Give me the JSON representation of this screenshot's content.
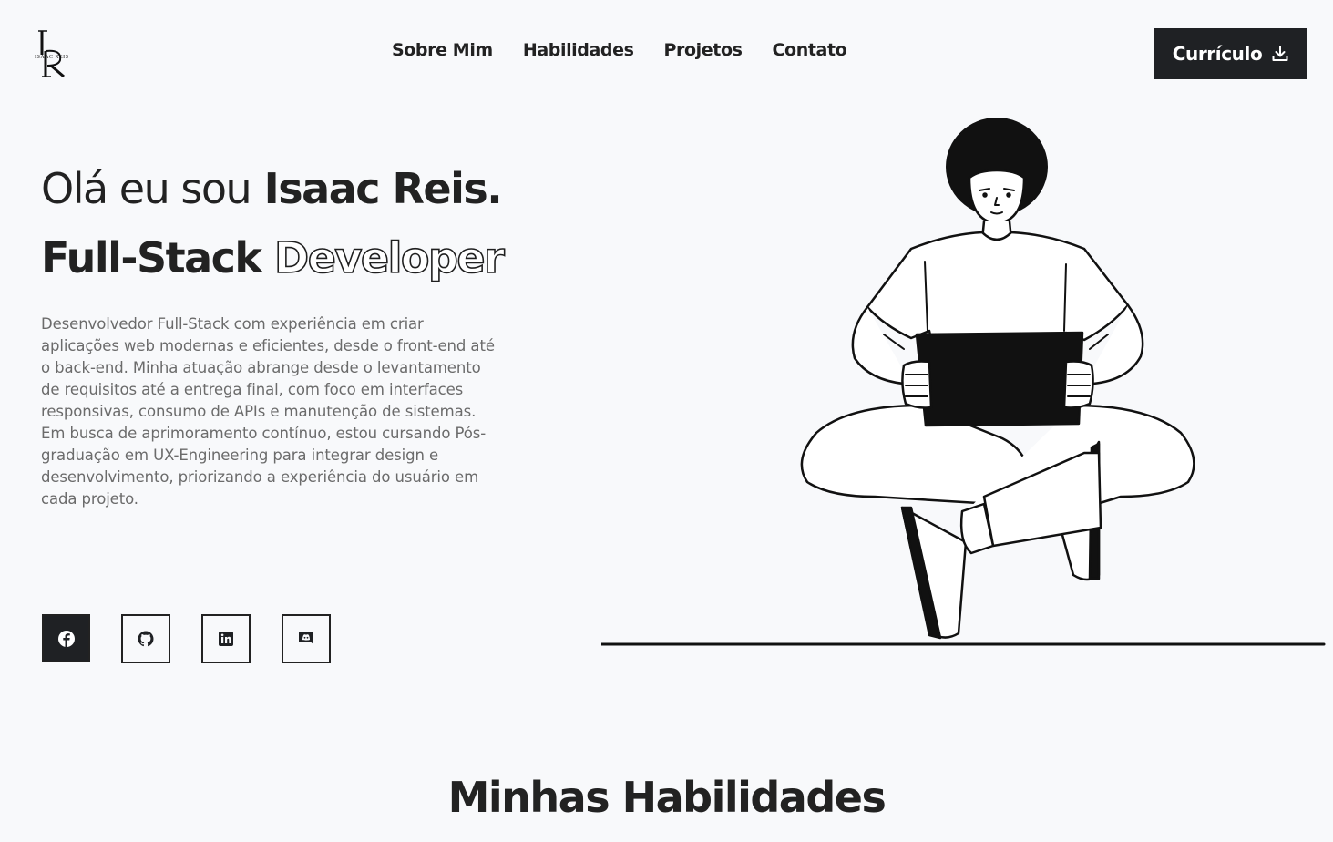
{
  "header": {
    "logo_alt": "IR",
    "logo_text": "ISAAC REIS",
    "nav": [
      {
        "label": "Sobre Mim"
      },
      {
        "label": "Habilidades"
      },
      {
        "label": "Projetos"
      },
      {
        "label": "Contato"
      }
    ],
    "cv_button": {
      "label": "Currículo",
      "icon": "download-icon"
    }
  },
  "hero": {
    "greeting_prefix": "Olá eu sou",
    "name": "Isaac Reis.",
    "role_bold": "Full-Stack",
    "role_outline": "Developer",
    "description": "Desenvolvedor Full-Stack com experiência em criar aplicações web modernas e eficientes, desde o front-end até o back-end. Minha atuação abrange desde o levantamento de requisitos até a entrega final, com foco em interfaces responsivas, consumo de APIs e manutenção de sistemas. Em busca de aprimoramento contínuo, estou cursando Pós-graduação em UX-Engineering para integrar design e desenvolvimento, priorizando a experiência do usuário em cada projeto.",
    "socials": [
      {
        "icon": "facebook-icon",
        "active": true
      },
      {
        "icon": "github-icon",
        "active": false
      },
      {
        "icon": "linkedin-icon",
        "active": false
      },
      {
        "icon": "discord-icon",
        "active": false
      }
    ],
    "illustration": "person-sitting-with-laptop-illustration"
  },
  "skills": {
    "title_light": "Minhas",
    "title_bold": "Habilidades"
  },
  "colors": {
    "background": "#f8f9fb",
    "text_dark": "#222222",
    "text_muted": "#6b6b6b",
    "button_bg": "#1f2124",
    "button_text": "#ffffff"
  }
}
